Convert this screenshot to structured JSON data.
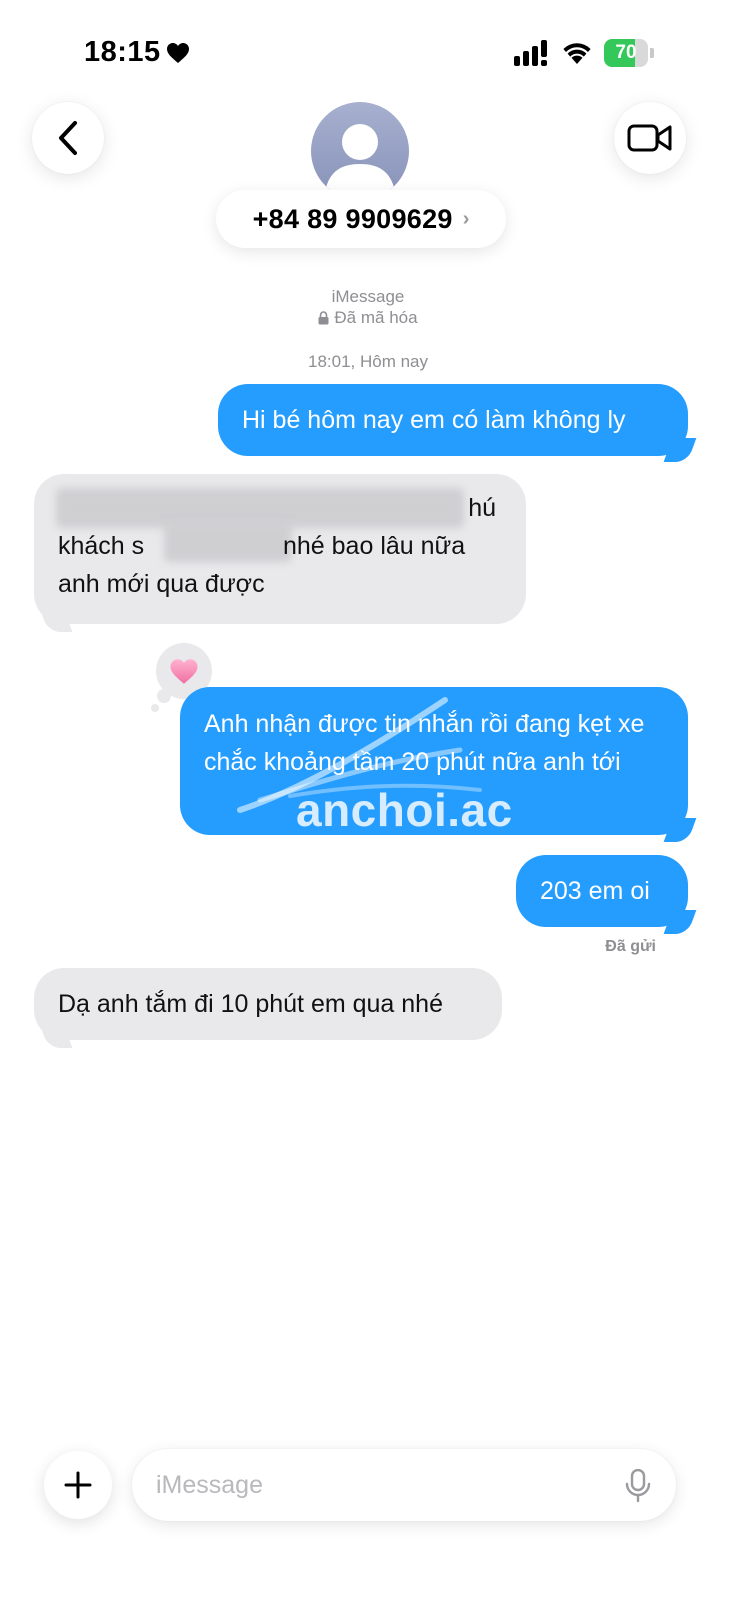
{
  "status_bar": {
    "time": "18:15",
    "battery_level": "70",
    "battery_fraction": 0.7,
    "icons": [
      "heart-icon",
      "signal-icon",
      "wifi-icon",
      "battery-icon"
    ]
  },
  "header": {
    "contact": "+84 89 9909629",
    "chevron": "›",
    "icons": [
      "back-chevron-icon",
      "avatar-person-icon",
      "video-camera-icon"
    ]
  },
  "conversation": {
    "service": "iMessage",
    "encryption": "Đã mã hóa",
    "timestamp": "18:01, Hôm nay",
    "messages": [
      {
        "from": "me",
        "text": "Hi bé hôm nay em có làm không ly"
      },
      {
        "from": "them",
        "line1_end": "hú",
        "line2_start": "khách s",
        "line2_end": "nhé bao lâu nữa",
        "line3": "anh mới qua được"
      },
      {
        "from": "me",
        "text": "Anh nhận được tin nhắn rồi đang kẹt xe chắc khoảng tầm 20 phút nữa anh tới"
      },
      {
        "from": "me",
        "text": "203 em oi"
      },
      {
        "from": "them",
        "text": "Dạ anh tắm đi 10 phút em qua nhé"
      }
    ],
    "reaction_icon": "heart-icon",
    "delivered": "Đã gửi",
    "watermark": "anchoi.ac"
  },
  "input_bar": {
    "placeholder": "iMessage",
    "icons": [
      "plus-icon",
      "microphone-icon"
    ]
  },
  "colors": {
    "outgoing_bubble": "#259dff",
    "incoming_bubble": "#e9e9eb",
    "battery_green": "#34c759",
    "reaction_heart": "#f27fae"
  }
}
